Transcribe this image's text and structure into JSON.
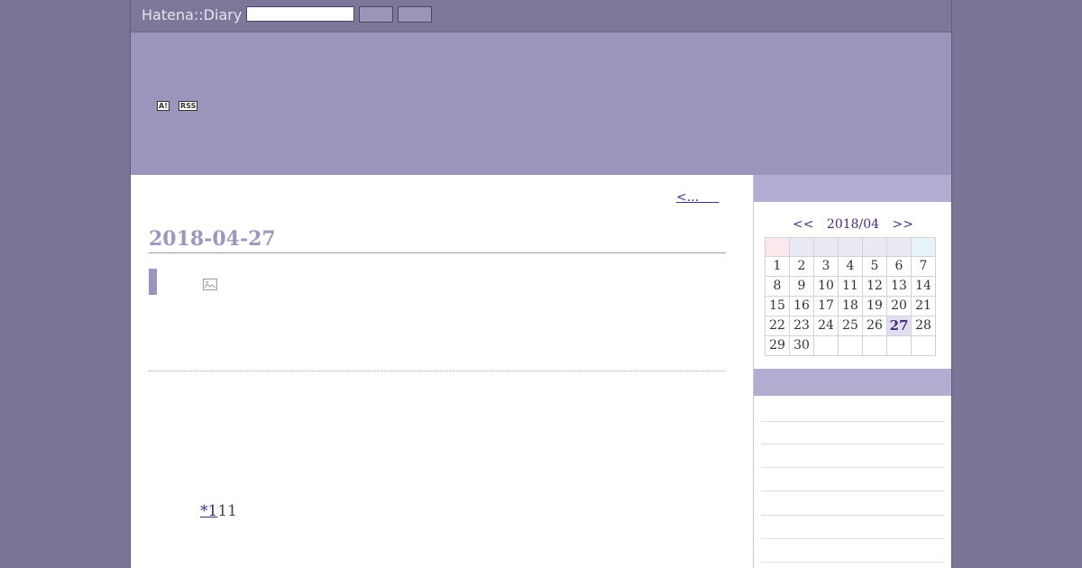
{
  "topbar": {
    "logo": "Hatena::Diary",
    "search_value": "",
    "search_button_label": "",
    "bar_button_label": ""
  },
  "header": {
    "antenna_badge": "A!",
    "rss_badge": "RSS"
  },
  "main": {
    "prev_link": "<...",
    "entry_date": "2018-04-27",
    "footnote_link": "*1",
    "footnote_text": "11"
  },
  "calendar": {
    "prev": "<<",
    "month": "2018/04",
    "next": ">>",
    "weekday_headers": [
      "",
      "",
      "",
      "",
      "",
      "",
      ""
    ],
    "weeks": [
      [
        "1",
        "2",
        "3",
        "4",
        "5",
        "6",
        "7"
      ],
      [
        "8",
        "9",
        "10",
        "11",
        "12",
        "13",
        "14"
      ],
      [
        "15",
        "16",
        "17",
        "18",
        "19",
        "20",
        "21"
      ],
      [
        "22",
        "23",
        "24",
        "25",
        "26",
        "27",
        "28"
      ],
      [
        "29",
        "30",
        "",
        "",
        "",
        "",
        ""
      ]
    ],
    "today": "27"
  },
  "colors": {
    "background": "#787596",
    "topbar": "#7c7899",
    "header": "#9995bb",
    "sidebar_head": "#b2aed2",
    "link": "#4b2a80",
    "date_title": "#9b98bf"
  }
}
